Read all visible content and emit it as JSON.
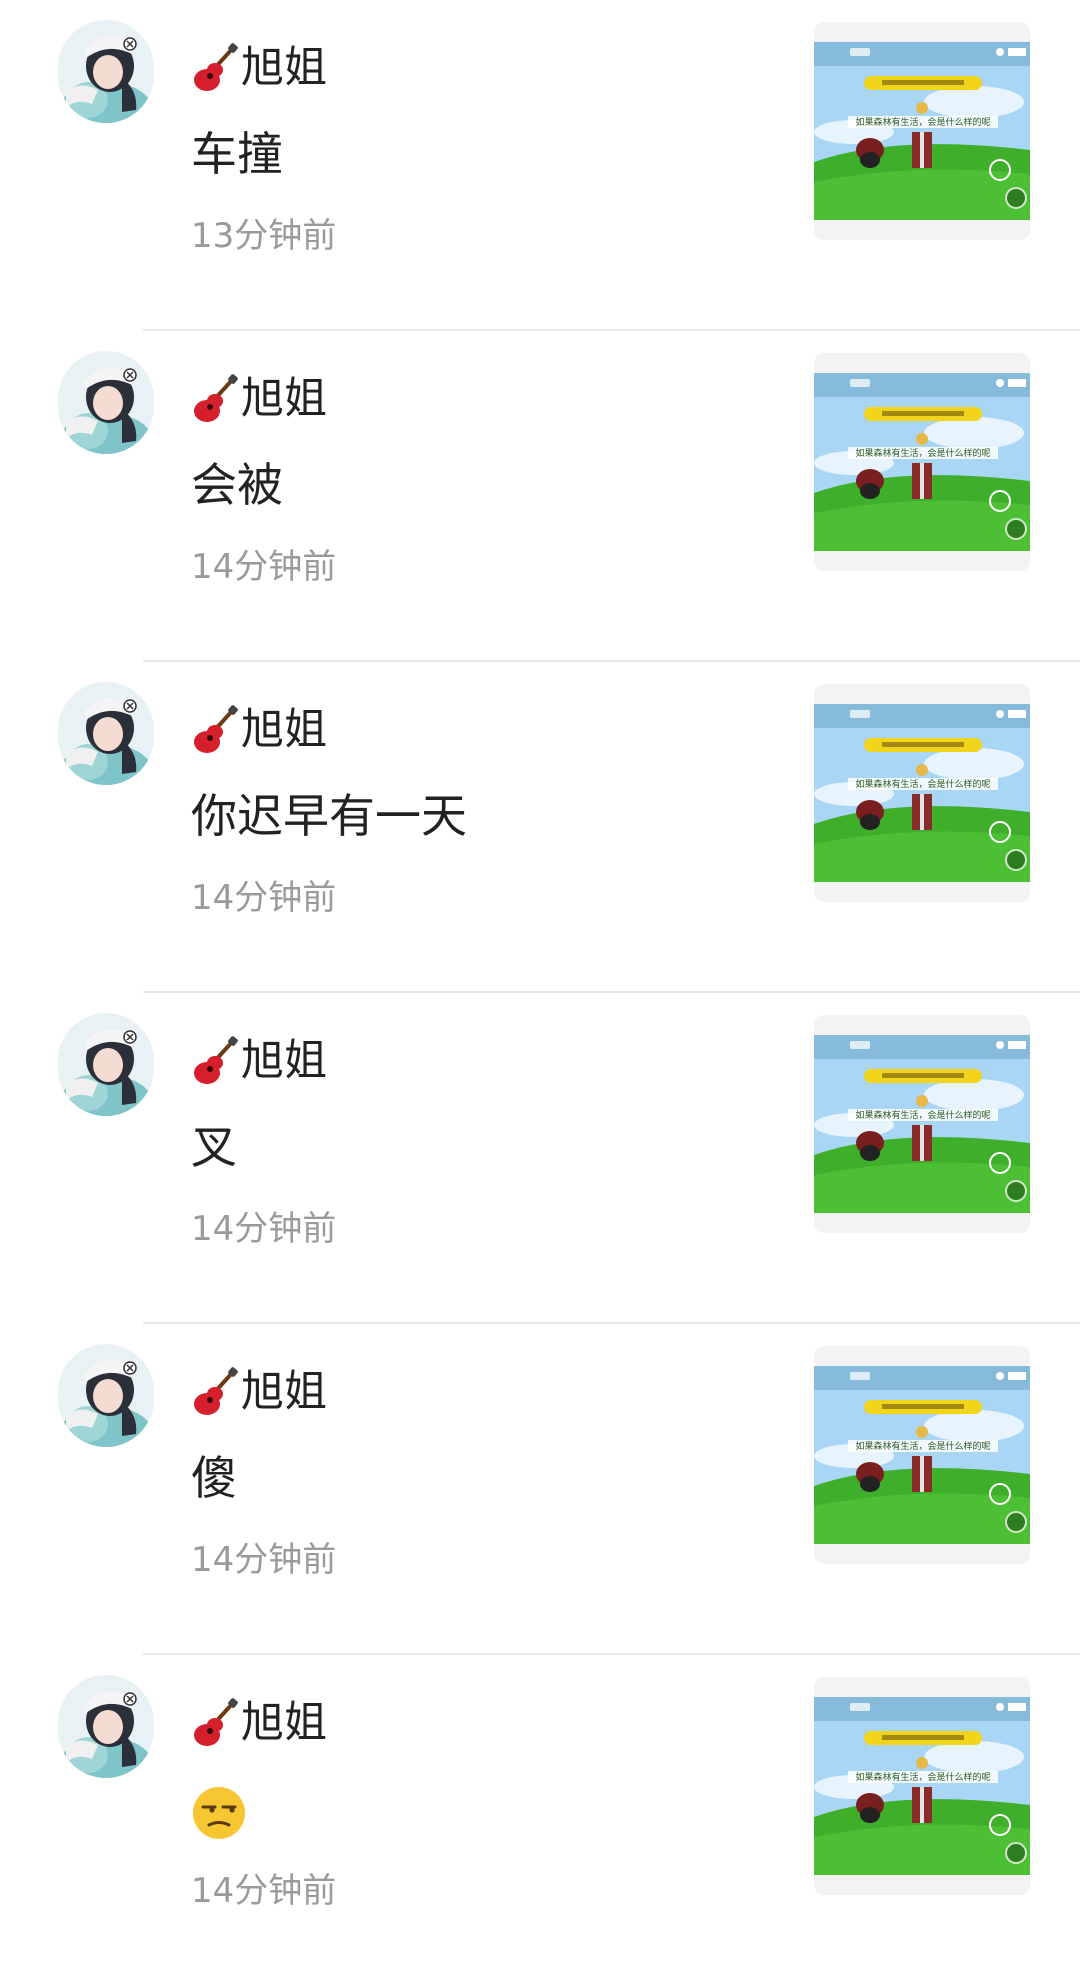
{
  "comments": [
    {
      "name": "旭姐",
      "message": "车撞",
      "time": "13分钟前",
      "emoji": ""
    },
    {
      "name": "旭姐",
      "message": "会被",
      "time": "14分钟前",
      "emoji": ""
    },
    {
      "name": "旭姐",
      "message": "你迟早有一天",
      "time": "14分钟前",
      "emoji": ""
    },
    {
      "name": "旭姐",
      "message": "叉",
      "time": "14分钟前",
      "emoji": ""
    },
    {
      "name": "旭姐",
      "message": "傻",
      "time": "14分钟前",
      "emoji": ""
    },
    {
      "name": "旭姐",
      "message": "",
      "time": "14分钟前",
      "emoji": "unamused-face"
    }
  ],
  "thumbnail": {
    "banner_text": "如果森林有生活，会是什么样的呢"
  },
  "colors": {
    "divider": "#e9e9e9",
    "time": "#9a9a9a",
    "grass": "#3fae2a",
    "sky": "#9ecdf2",
    "banner": "#f2d51a"
  }
}
